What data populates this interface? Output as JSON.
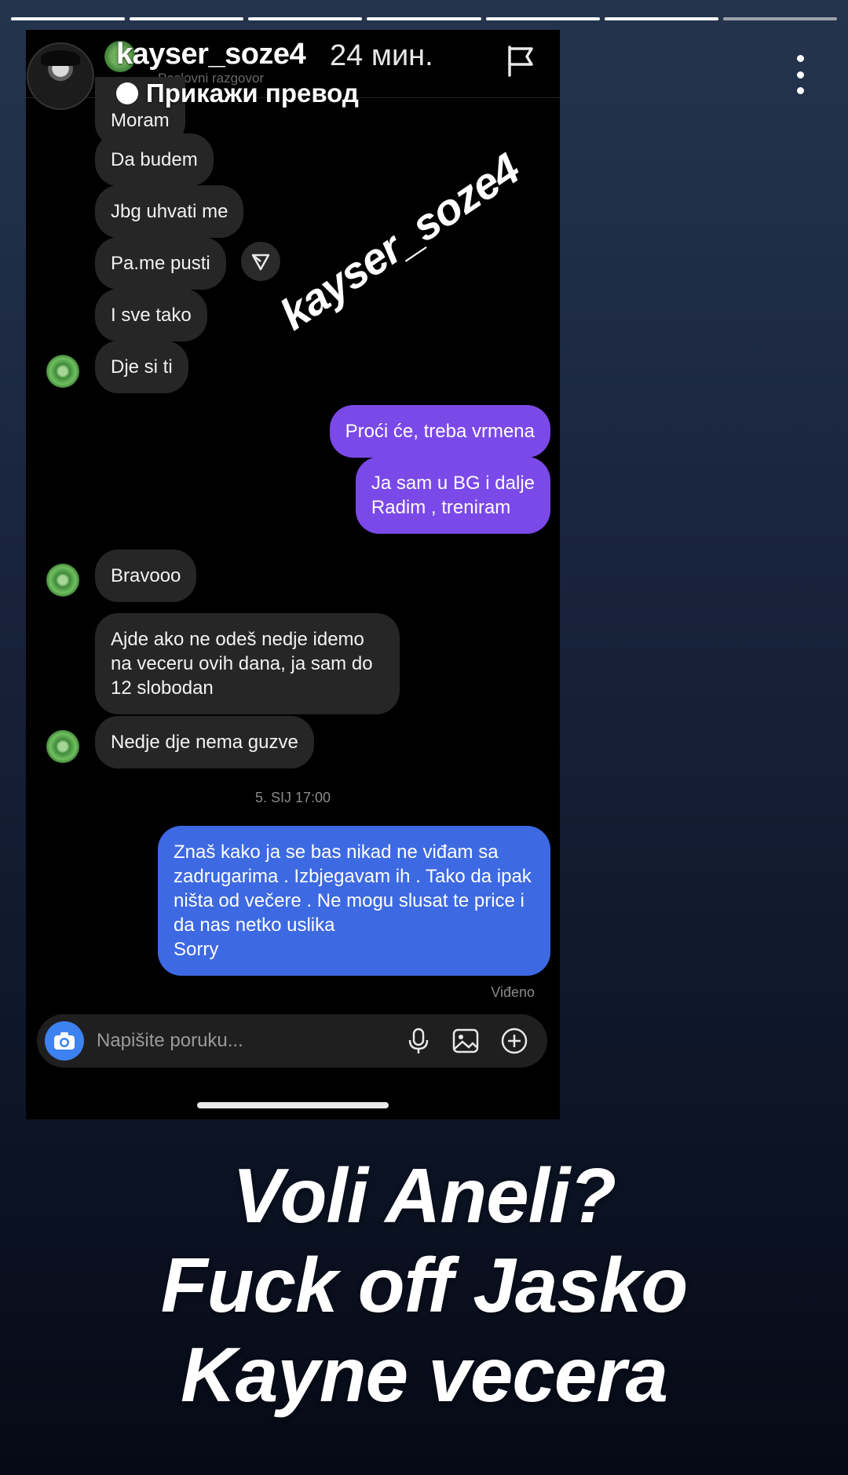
{
  "story": {
    "progress_total": 7,
    "progress_done": 6,
    "username": "kayser_soze4",
    "time_ago": "24 мин.",
    "translate_label": "Прикажи превод"
  },
  "chat": {
    "subtitle": "Poslovni razgovor",
    "messages": [
      {
        "text": "Moram",
        "side": "in"
      },
      {
        "text": "Da budem",
        "side": "in"
      },
      {
        "text": "Jbg uhvati me",
        "side": "in"
      },
      {
        "text": "Pa.me pusti",
        "side": "in"
      },
      {
        "text": "I sve tako",
        "side": "in"
      },
      {
        "text": "Dje si ti",
        "side": "in"
      },
      {
        "text": "Proći će, treba vrmena",
        "side": "out"
      },
      {
        "text_line1": "Ja sam u BG i dalje",
        "text_line2": "Radim , treniram",
        "side": "out"
      },
      {
        "text": "Bravooo",
        "side": "in"
      },
      {
        "text": "Ajde ako ne odeš nedje idemo na veceru ovih dana, ja sam do 12 slobodan",
        "side": "in"
      },
      {
        "text": "Nedje dje nema guzve",
        "side": "in"
      },
      {
        "text": "Znaš kako ja se bas nikad ne viđam sa zadrugarima . Izbjegavam ih . Tako da ipak ništa od večere . Ne mogu slusat te price i da nas netko uslika",
        "text_extra": "Sorry",
        "side": "out"
      }
    ],
    "timestamp": "5. SIJ 17:00",
    "seen_label": "Viđeno",
    "composer_placeholder": "Napišite poruku...",
    "colors": {
      "out_purple": "#7b49e8",
      "out_blue": "#3d69e2",
      "in_bubble": "#262626"
    }
  },
  "watermark": "kayser_soze4",
  "caption": {
    "line1": "Voli Aneli?",
    "line2": "Fuck off Jasko",
    "line3": "Kayne vecera"
  },
  "icons": [
    "flag-icon",
    "more-icon",
    "share-icon",
    "camera-icon",
    "mic-icon",
    "image-icon",
    "plus-icon"
  ]
}
